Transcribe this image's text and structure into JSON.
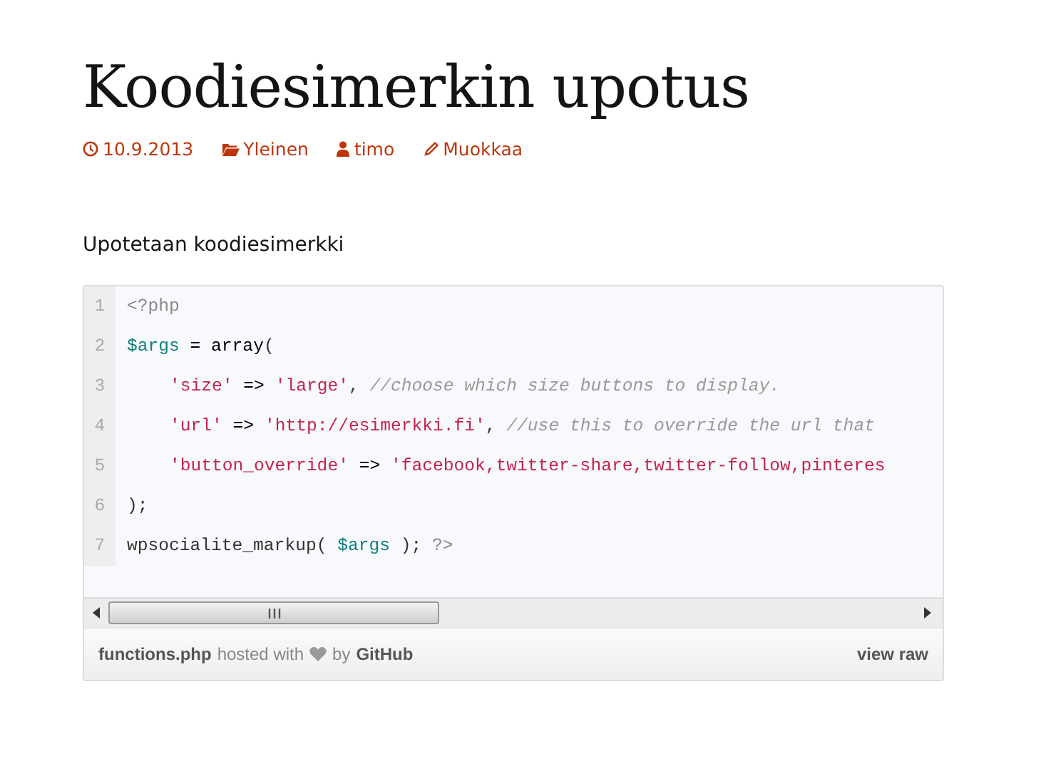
{
  "post": {
    "title": "Koodiesimerkin upotus",
    "meta": [
      {
        "kind": "date",
        "text": "10.9.2013"
      },
      {
        "kind": "category",
        "text": "Yleinen"
      },
      {
        "kind": "author",
        "text": "timo"
      },
      {
        "kind": "edit",
        "text": "Muokkaa"
      }
    ],
    "intro": "Upotetaan koodiesimerkki"
  },
  "gist": {
    "lines": [
      {
        "number": "1",
        "indented": false,
        "tokens": [
          {
            "kind": "meta",
            "text": "<?php"
          }
        ]
      },
      {
        "number": "2",
        "indented": false,
        "tokens": [
          {
            "kind": "var",
            "text": "$args"
          },
          {
            "kind": "op",
            "text": " = "
          },
          {
            "kind": "func",
            "text": "array"
          },
          {
            "kind": "plain",
            "text": "("
          }
        ]
      },
      {
        "number": "3",
        "indented": true,
        "tokens": [
          {
            "kind": "string",
            "text": "'size'"
          },
          {
            "kind": "op",
            "text": " => "
          },
          {
            "kind": "string",
            "text": "'large'"
          },
          {
            "kind": "plain",
            "text": ", "
          },
          {
            "kind": "comment",
            "text": "//choose which size buttons to display."
          }
        ]
      },
      {
        "number": "4",
        "indented": true,
        "tokens": [
          {
            "kind": "string",
            "text": "'url'"
          },
          {
            "kind": "op",
            "text": " => "
          },
          {
            "kind": "string",
            "text": "'http://esimerkki.fi'"
          },
          {
            "kind": "plain",
            "text": ", "
          },
          {
            "kind": "comment",
            "text": "//use this to override the url that"
          }
        ]
      },
      {
        "number": "5",
        "indented": true,
        "tokens": [
          {
            "kind": "string",
            "text": "'button_override'"
          },
          {
            "kind": "op",
            "text": " => "
          },
          {
            "kind": "string",
            "text": "'facebook,twitter-share,twitter-follow,pinteres"
          }
        ]
      },
      {
        "number": "6",
        "indented": false,
        "tokens": [
          {
            "kind": "plain",
            "text": ");"
          }
        ]
      },
      {
        "number": "7",
        "indented": false,
        "tokens": [
          {
            "kind": "plain",
            "text": "wpsocialite_markup( "
          },
          {
            "kind": "var",
            "text": "$args"
          },
          {
            "kind": "plain",
            "text": " ); "
          },
          {
            "kind": "meta",
            "text": "?>"
          }
        ]
      }
    ],
    "footer": {
      "filename": "functions.php",
      "hosted": "hosted with",
      "by": "by",
      "host": "GitHub",
      "raw": "view raw"
    }
  }
}
